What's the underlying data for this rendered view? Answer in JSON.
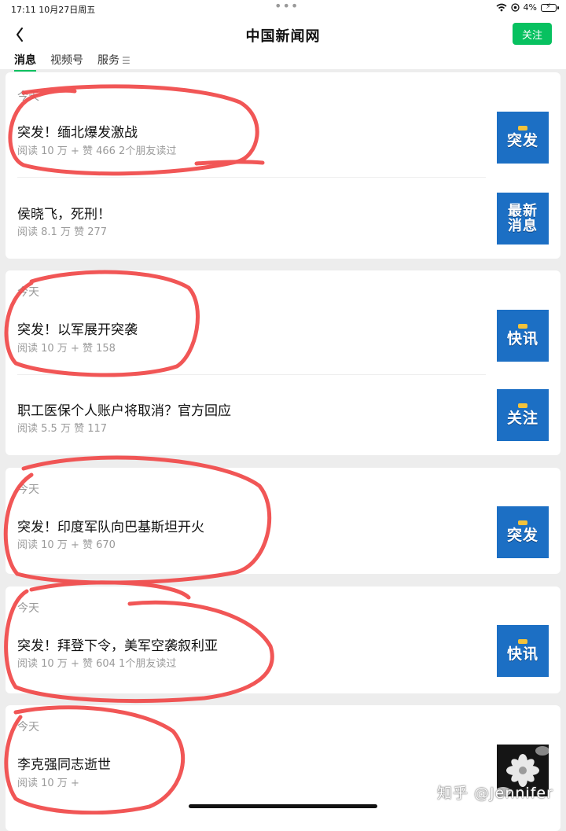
{
  "status": {
    "time": "17:11",
    "date": "10月27日周五",
    "battery": "4%"
  },
  "header": {
    "title": "中国新闻网",
    "follow_label": "关注"
  },
  "tabs": [
    {
      "label": "消息"
    },
    {
      "label": "视频号"
    },
    {
      "label": "服务"
    }
  ],
  "groups": [
    {
      "date": "今天",
      "articles": [
        {
          "title": "突发！缅北爆发激战",
          "meta": "阅读 10 万 +   赞 466   2个朋友读过",
          "thumb": "突发"
        },
        {
          "title": "侯晓飞，死刑！",
          "meta": "阅读 8.1 万   赞 277",
          "thumb": "最新消息"
        }
      ]
    },
    {
      "date": "今天",
      "articles": [
        {
          "title": "突发！以军展开突袭",
          "meta": "阅读 10 万 +   赞 158",
          "thumb": "快讯"
        },
        {
          "title": "职工医保个人账户将取消？官方回应",
          "meta": "阅读 5.5 万   赞 117",
          "thumb": "关注"
        }
      ]
    },
    {
      "date": "今天",
      "articles": [
        {
          "title": "突发！印度军队向巴基斯坦开火",
          "meta": "阅读 10 万 +   赞 670",
          "thumb": "突发"
        }
      ]
    },
    {
      "date": "今天",
      "articles": [
        {
          "title": "突发！拜登下令，美军空袭叙利亚",
          "meta": "阅读 10 万 +   赞 604   1个朋友读过",
          "thumb": "快讯"
        }
      ]
    },
    {
      "date": "今天",
      "articles": [
        {
          "title": "李克强同志逝世",
          "meta": "阅读 10 万 +",
          "thumb": ""
        }
      ]
    }
  ],
  "watermark": "知乎 @Jennifer",
  "colors": {
    "accent": "#07c160",
    "thumb_blue": "#1c6fc4",
    "annotation": "#f04848"
  }
}
